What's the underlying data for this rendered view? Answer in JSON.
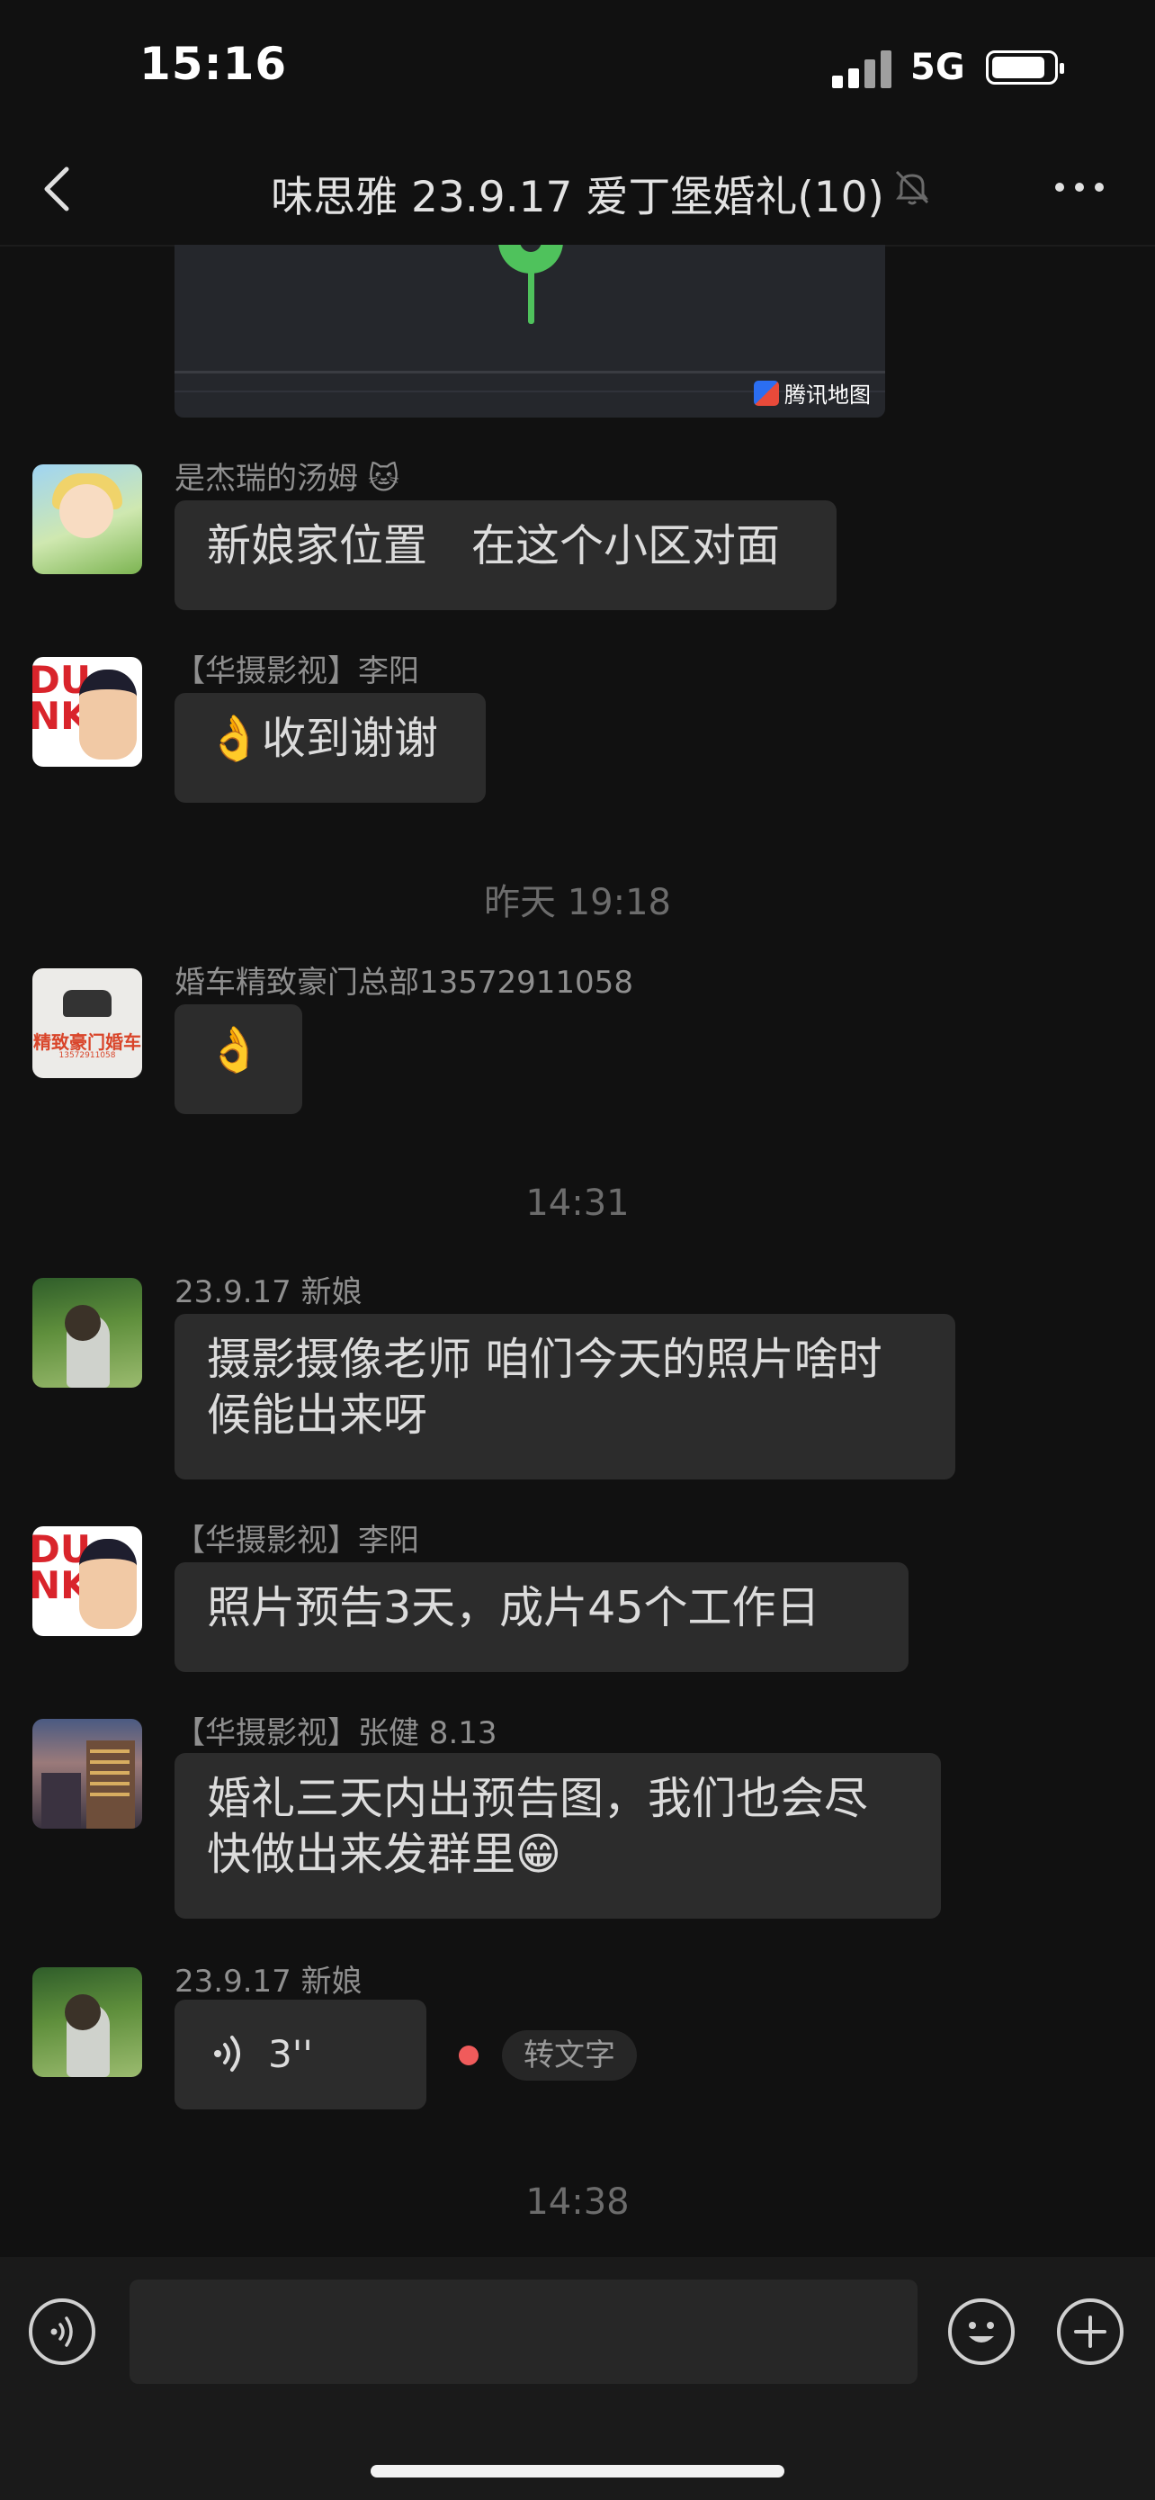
{
  "status_bar": {
    "time": "15:16",
    "network": "5G",
    "battery_level": 0.8
  },
  "header": {
    "title": "味思雅 23.9.17 爱丁堡婚礼(10)",
    "muted": true
  },
  "map_card": {
    "credit": "腾讯地图"
  },
  "messages": [
    {
      "sender": "是杰瑞的汤姆 🐱",
      "text": "新娘家位置　在这个小区对面"
    },
    {
      "sender": "【华摄影视】李阳",
      "text": "👌收到谢谢"
    },
    {
      "timestamp": "昨天 19:18"
    },
    {
      "sender": "婚车精致豪门总部13572911058",
      "text": "👌"
    },
    {
      "timestamp": "14:31"
    },
    {
      "sender": "23.9.17 新娘",
      "text_lines": [
        "摄影摄像老师 咱们今天的照片啥时",
        "候能出来呀"
      ]
    },
    {
      "sender": "【华摄影视】李阳",
      "text": "照片预告3天，成片45个工作日"
    },
    {
      "sender": "【华摄影视】张健 8.13",
      "text_lines": [
        "婚礼三天内出预告图，我们也会尽",
        "快做出来发群里😁"
      ]
    },
    {
      "sender": "23.9.17 新娘",
      "voice_duration": "3''",
      "convert_label": "转文字"
    },
    {
      "timestamp": "14:38"
    }
  ],
  "avatars": {
    "car_brand": "精致豪门婚车",
    "car_phone": "13572911058",
    "dunk_letters": "DU\nNK"
  },
  "input_bar": {
    "placeholder": ""
  },
  "colors": {
    "background": "#111111",
    "bubble": "#2c2c2c",
    "sender_text": "#8f8f8f",
    "timestamp_text": "#6c6c6c",
    "map_pin": "#4fc25c",
    "unread_dot": "#f05b5b"
  },
  "icons": {
    "back": "chevron-left-icon",
    "mute": "bell-off-icon",
    "more": "more-dots-icon",
    "voice": "voice-icon",
    "emoji": "emoji-icon",
    "plus": "plus-icon"
  }
}
